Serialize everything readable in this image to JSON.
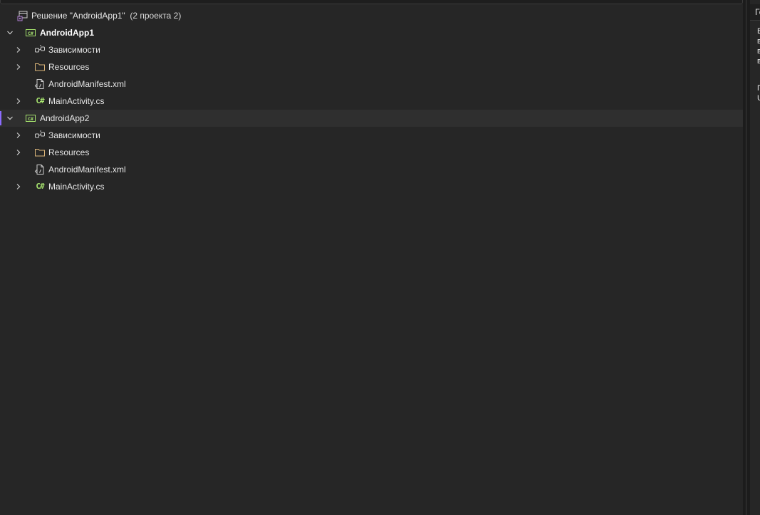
{
  "solution": {
    "label": "Решение \"AndroidApp1\"",
    "count": "(2 проекта 2)"
  },
  "projects": [
    {
      "name": "AndroidApp1",
      "items": [
        {
          "label": "Зависимости"
        },
        {
          "label": "Resources"
        },
        {
          "label": "AndroidManifest.xml"
        },
        {
          "label": "MainActivity.cs"
        }
      ]
    },
    {
      "name": "AndroidApp2",
      "items": [
        {
          "label": "Зависимости"
        },
        {
          "label": "Resources"
        },
        {
          "label": "AndroidManifest.xml"
        },
        {
          "label": "MainActivity.cs"
        }
      ]
    }
  ],
  "icons": {
    "solution": "solution-icon",
    "project": "csharp-project-icon",
    "dependencies": "dependencies-icon",
    "folder": "folder-icon",
    "xml_file": "xml-file-icon",
    "cs_file": "csharp-file-icon",
    "cs_glyph": "C#"
  },
  "colors": {
    "background": "#262626",
    "selection": "#2f2f2f",
    "accent": "#8c6cff",
    "csharp": "#a6e36e",
    "folder": "#dcb67a"
  },
  "side_panel": {
    "header": "Го",
    "lines": [
      "В",
      "в",
      "в",
      "в",
      "П",
      "U"
    ]
  }
}
